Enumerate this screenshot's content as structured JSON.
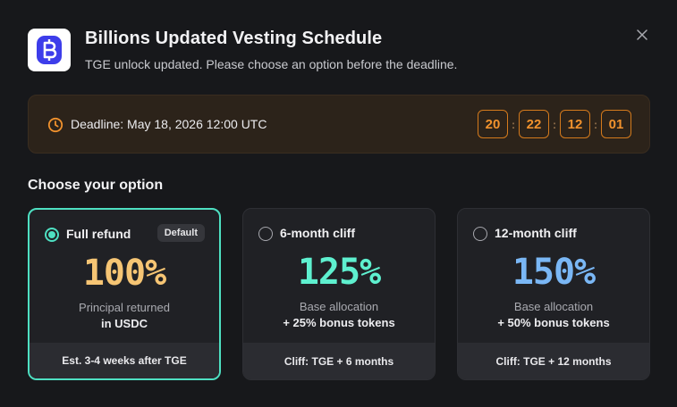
{
  "header": {
    "title": "Billions Updated Vesting Schedule",
    "subtitle": "TGE unlock updated. Please choose an option before the deadline.",
    "logo_icon": "billions-logo-icon",
    "close_icon": "close-icon"
  },
  "deadline": {
    "label": "Deadline: May 18, 2026 12:00 UTC",
    "icon": "clock-icon",
    "countdown": [
      "20",
      "22",
      "12",
      "01"
    ],
    "separator": ":"
  },
  "options_heading": "Choose your option",
  "options": [
    {
      "name": "Full refund",
      "badge": "Default",
      "selected": true,
      "percent": "100%",
      "percent_color": "#f6c574",
      "line1": "Principal returned",
      "line2": "in USDC",
      "footer": "Est. 3-4 weeks after TGE"
    },
    {
      "name": "6-month cliff",
      "selected": false,
      "percent": "125%",
      "percent_color": "#5ef0cf",
      "line1": "Base allocation",
      "line2": "+ 25% bonus tokens",
      "footer": "Cliff: TGE + 6 months"
    },
    {
      "name": "12-month cliff",
      "selected": false,
      "percent": "150%",
      "percent_color": "#7ab7f5",
      "line1": "Base allocation",
      "line2": "+ 50% bonus tokens",
      "footer": "Cliff: TGE + 12 months"
    }
  ],
  "colors": {
    "accent_selected": "#4ee0c2",
    "timer": "#f1922d",
    "logo": "#3d3dea"
  }
}
